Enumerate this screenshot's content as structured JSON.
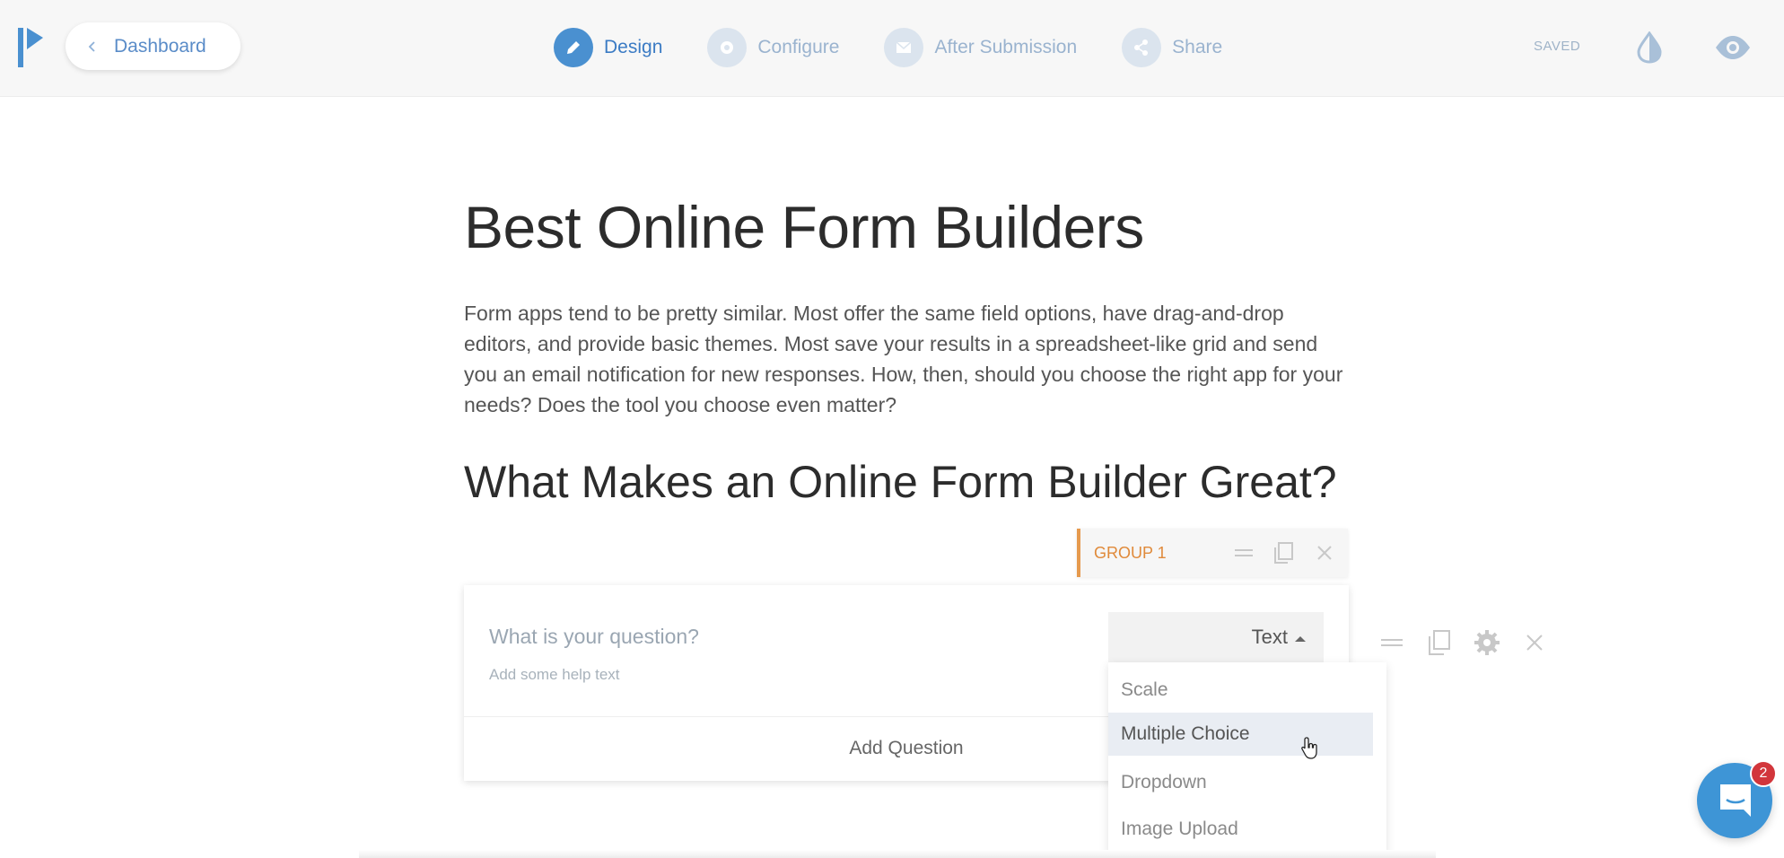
{
  "header": {
    "back_label": "Dashboard",
    "steps": [
      {
        "label": "Design",
        "icon": "pencil-icon",
        "active": true
      },
      {
        "label": "Configure",
        "icon": "gear-icon",
        "active": false
      },
      {
        "label": "After Submission",
        "icon": "envelope-icon",
        "active": false
      },
      {
        "label": "Share",
        "icon": "share-icon",
        "active": false
      }
    ],
    "status": "SAVED"
  },
  "form": {
    "title": "Best Online Form Builders",
    "description": "Form apps tend to be pretty similar. Most offer the same field options, have drag-and-drop editors, and provide basic themes. Most save your results in a spreadsheet-like grid and send you an email notification for new responses. How, then, should you choose the right app for your needs? Does the tool you choose even matter?",
    "section_heading": "What Makes an Online Form Builder Great?"
  },
  "group": {
    "label": "GROUP 1"
  },
  "question": {
    "placeholder": "What is your question?",
    "help_placeholder": "Add some help text",
    "type_selected": "Text",
    "add_label": "Add Question"
  },
  "type_options": [
    "Scale",
    "Multiple Choice",
    "Dropdown",
    "Image Upload"
  ],
  "chat": {
    "unread_count": "2"
  },
  "colors": {
    "accent": "#3b7bc4",
    "group_accent": "#e69a4e",
    "badge": "#d2363b",
    "chat": "#3e95d6"
  }
}
